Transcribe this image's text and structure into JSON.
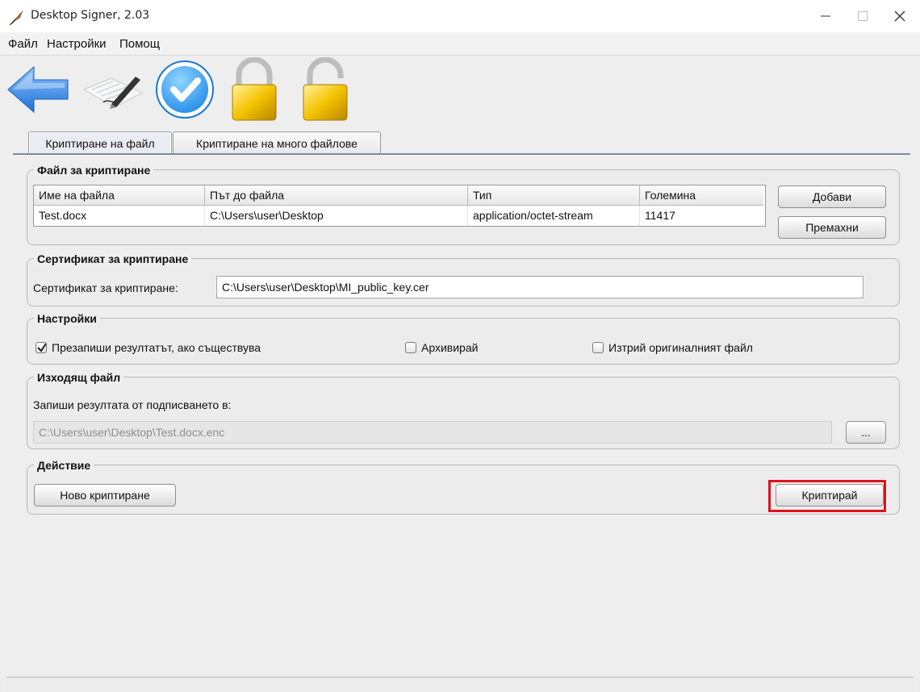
{
  "window": {
    "title": "Desktop Signer, 2.03",
    "controls": {
      "minimize": "minimize-icon",
      "maximize": "maximize-icon",
      "close": "close-icon"
    }
  },
  "menu": [
    "Файл",
    "Настройки",
    "Помощ"
  ],
  "toolbar": {
    "icons": [
      "back-arrow-icon",
      "sign-document-icon",
      "verify-check-icon",
      "lock-icon",
      "unlock-icon"
    ]
  },
  "tabs": [
    {
      "label": "Криптиране на файл",
      "active": true
    },
    {
      "label": "Криптиране на много файлове",
      "active": false
    }
  ],
  "file_section": {
    "title": "Файл за криптиране",
    "columns": [
      "Име на файла",
      "Път до файла",
      "Тип",
      "Големина"
    ],
    "rows": [
      [
        "Test.docx",
        "C:\\Users\\user\\Desktop",
        "application/octet-stream",
        "11417"
      ]
    ],
    "add_label": "Добави",
    "remove_label": "Премахни"
  },
  "certificate_section": {
    "title": "Сертификат за криптиране",
    "label": "Сертификат за криптиране:",
    "value": "C:\\Users\\user\\Desktop\\MI_public_key.cer"
  },
  "settings_section": {
    "title": "Настройки",
    "options": [
      {
        "label": "Презапиши резултатът, ако съществува",
        "checked": true
      },
      {
        "label": "Архивирай",
        "checked": false
      },
      {
        "label": "Изтрий оригиналният файл",
        "checked": false
      }
    ]
  },
  "output_section": {
    "title": "Изходящ файл",
    "label": "Запиши резултата от подписването в:",
    "value": "C:\\Users\\user\\Desktop\\Test.docx.enc",
    "browse_label": "..."
  },
  "action_section": {
    "title": "Действие",
    "new_label": "Ново криптиране",
    "encrypt_label": "Криптирай"
  },
  "colors": {
    "highlight": "#e0111b",
    "window_bg": "#eeeeee"
  }
}
